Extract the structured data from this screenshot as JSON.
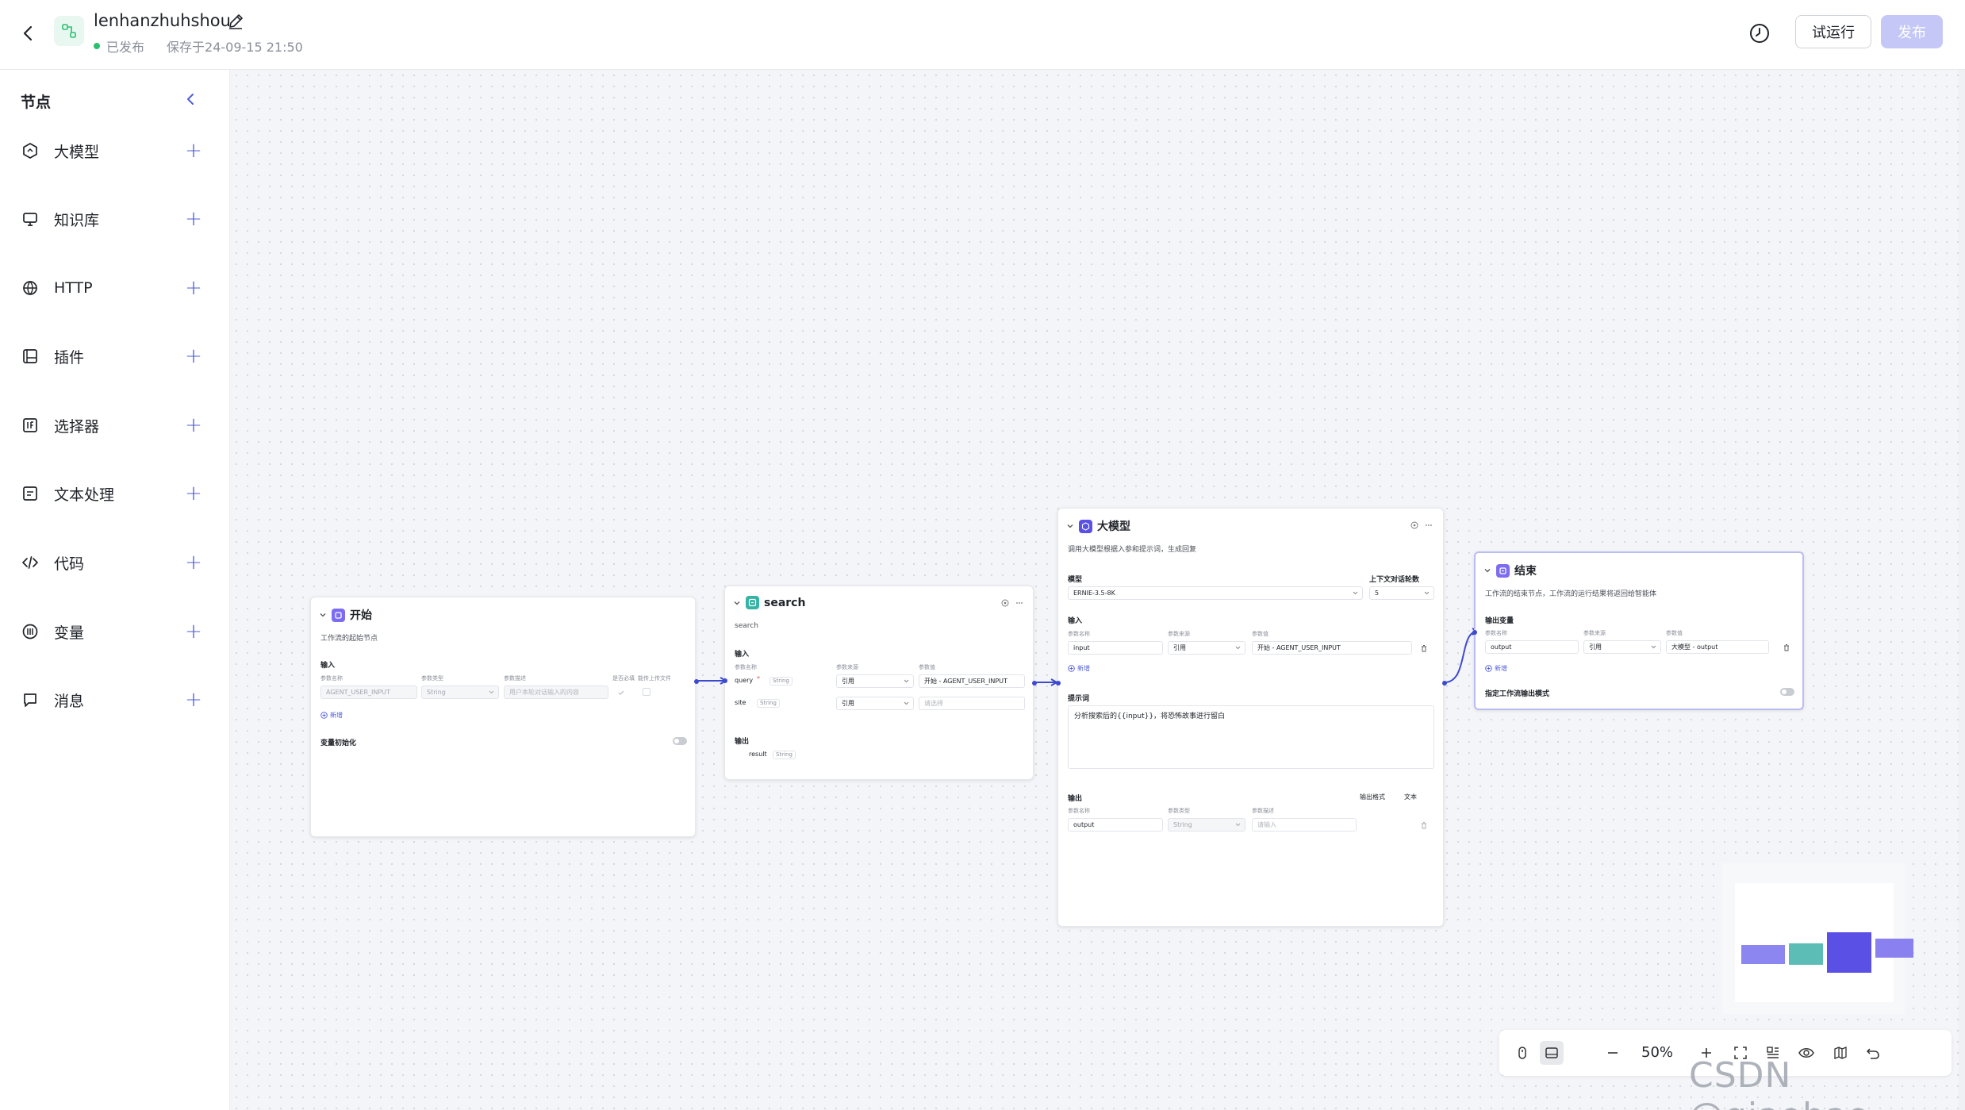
{
  "header": {
    "app_name": "lenhanzhuhshou",
    "status": "已发布",
    "saved_at": "保存于24-09-15 21:50",
    "run_label": "试运行",
    "publish_label": "发布",
    "publish_color": "#c5c8f6",
    "status_color": "#2bbf6f"
  },
  "sidebar": {
    "title": "节点",
    "items": [
      {
        "label": "大模型",
        "icon": "hexagon-icon"
      },
      {
        "label": "知识库",
        "icon": "monitor-icon"
      },
      {
        "label": "HTTP",
        "icon": "globe-icon"
      },
      {
        "label": "插件",
        "icon": "plugin-icon"
      },
      {
        "label": "选择器",
        "icon": "selector-icon"
      },
      {
        "label": "文本处理",
        "icon": "text-icon"
      },
      {
        "label": "代码",
        "icon": "code-icon"
      },
      {
        "label": "变量",
        "icon": "variable-icon"
      },
      {
        "label": "消息",
        "icon": "message-icon"
      }
    ]
  },
  "nodes": {
    "start": {
      "title": "开始",
      "desc": "工作流的起始节点",
      "input_label": "输入",
      "col_name": "参数名称",
      "col_type": "参数类型",
      "col_desc": "参数描述",
      "col_required": "是否必填",
      "col_upload": "能传上传文件",
      "param_name": "AGENT_USER_INPUT",
      "param_type": "String",
      "param_desc_placeholder": "用户本轮对话输入的内容",
      "add_label": "新增",
      "init_label": "变量初始化"
    },
    "search": {
      "title": "search",
      "desc": "search",
      "input_label": "输入",
      "col_name": "参数名称",
      "col_source": "参数来源",
      "col_value": "参数值",
      "rows": [
        {
          "name": "query",
          "type": "String",
          "source": "引用",
          "value": "开始 - AGENT_USER_INPUT"
        },
        {
          "name": "site",
          "type": "String",
          "source": "引用",
          "value_placeholder": "请选择"
        }
      ],
      "output_label": "输出",
      "output_name": "result",
      "output_type": "String"
    },
    "llm": {
      "title": "大模型",
      "desc": "调用大模型根据入参和提示词，生成回复",
      "model_label": "模型",
      "model_value": "ERNIE-3.5-8K",
      "context_label": "上下文对话轮数",
      "context_value": "5",
      "input_label": "输入",
      "col_name": "参数名称",
      "col_source": "参数来源",
      "col_value": "参数值",
      "input_name": "input",
      "input_source": "引用",
      "input_value": "开始 - AGENT_USER_INPUT",
      "add_label": "新增",
      "prompt_label": "提示词",
      "prompt_text": "分析搜索后的{{input}}，将恐怖故事进行留白",
      "output_label": "输出",
      "output_format_label": "输出格式",
      "output_format_value": "文本",
      "out_col_name": "参数名称",
      "out_col_type": "参数类型",
      "out_col_desc": "参数描述",
      "output_name": "output",
      "output_type": "String",
      "output_desc_placeholder": "请输入"
    },
    "end": {
      "title": "结束",
      "desc": "工作流的结束节点，工作流的运行结果将返回给智能体",
      "output_var_label": "输出变量",
      "col_name": "参数名称",
      "col_source": "参数来源",
      "col_value": "参数值",
      "var_name": "output",
      "var_source": "引用",
      "var_value": "大模型 - output",
      "add_label": "新增",
      "stream_label": "指定工作流输出模式"
    }
  },
  "toolbar": {
    "zoom": "50%"
  },
  "colors": {
    "accent": "#4e5bdb",
    "edge": "#3d4ad0",
    "minimap_start": "#8b86f0",
    "minimap_search": "#5bbdb5",
    "minimap_llm": "#5a50e6",
    "minimap_end": "#8a80f0"
  },
  "watermark": "CSDN @giaobao"
}
